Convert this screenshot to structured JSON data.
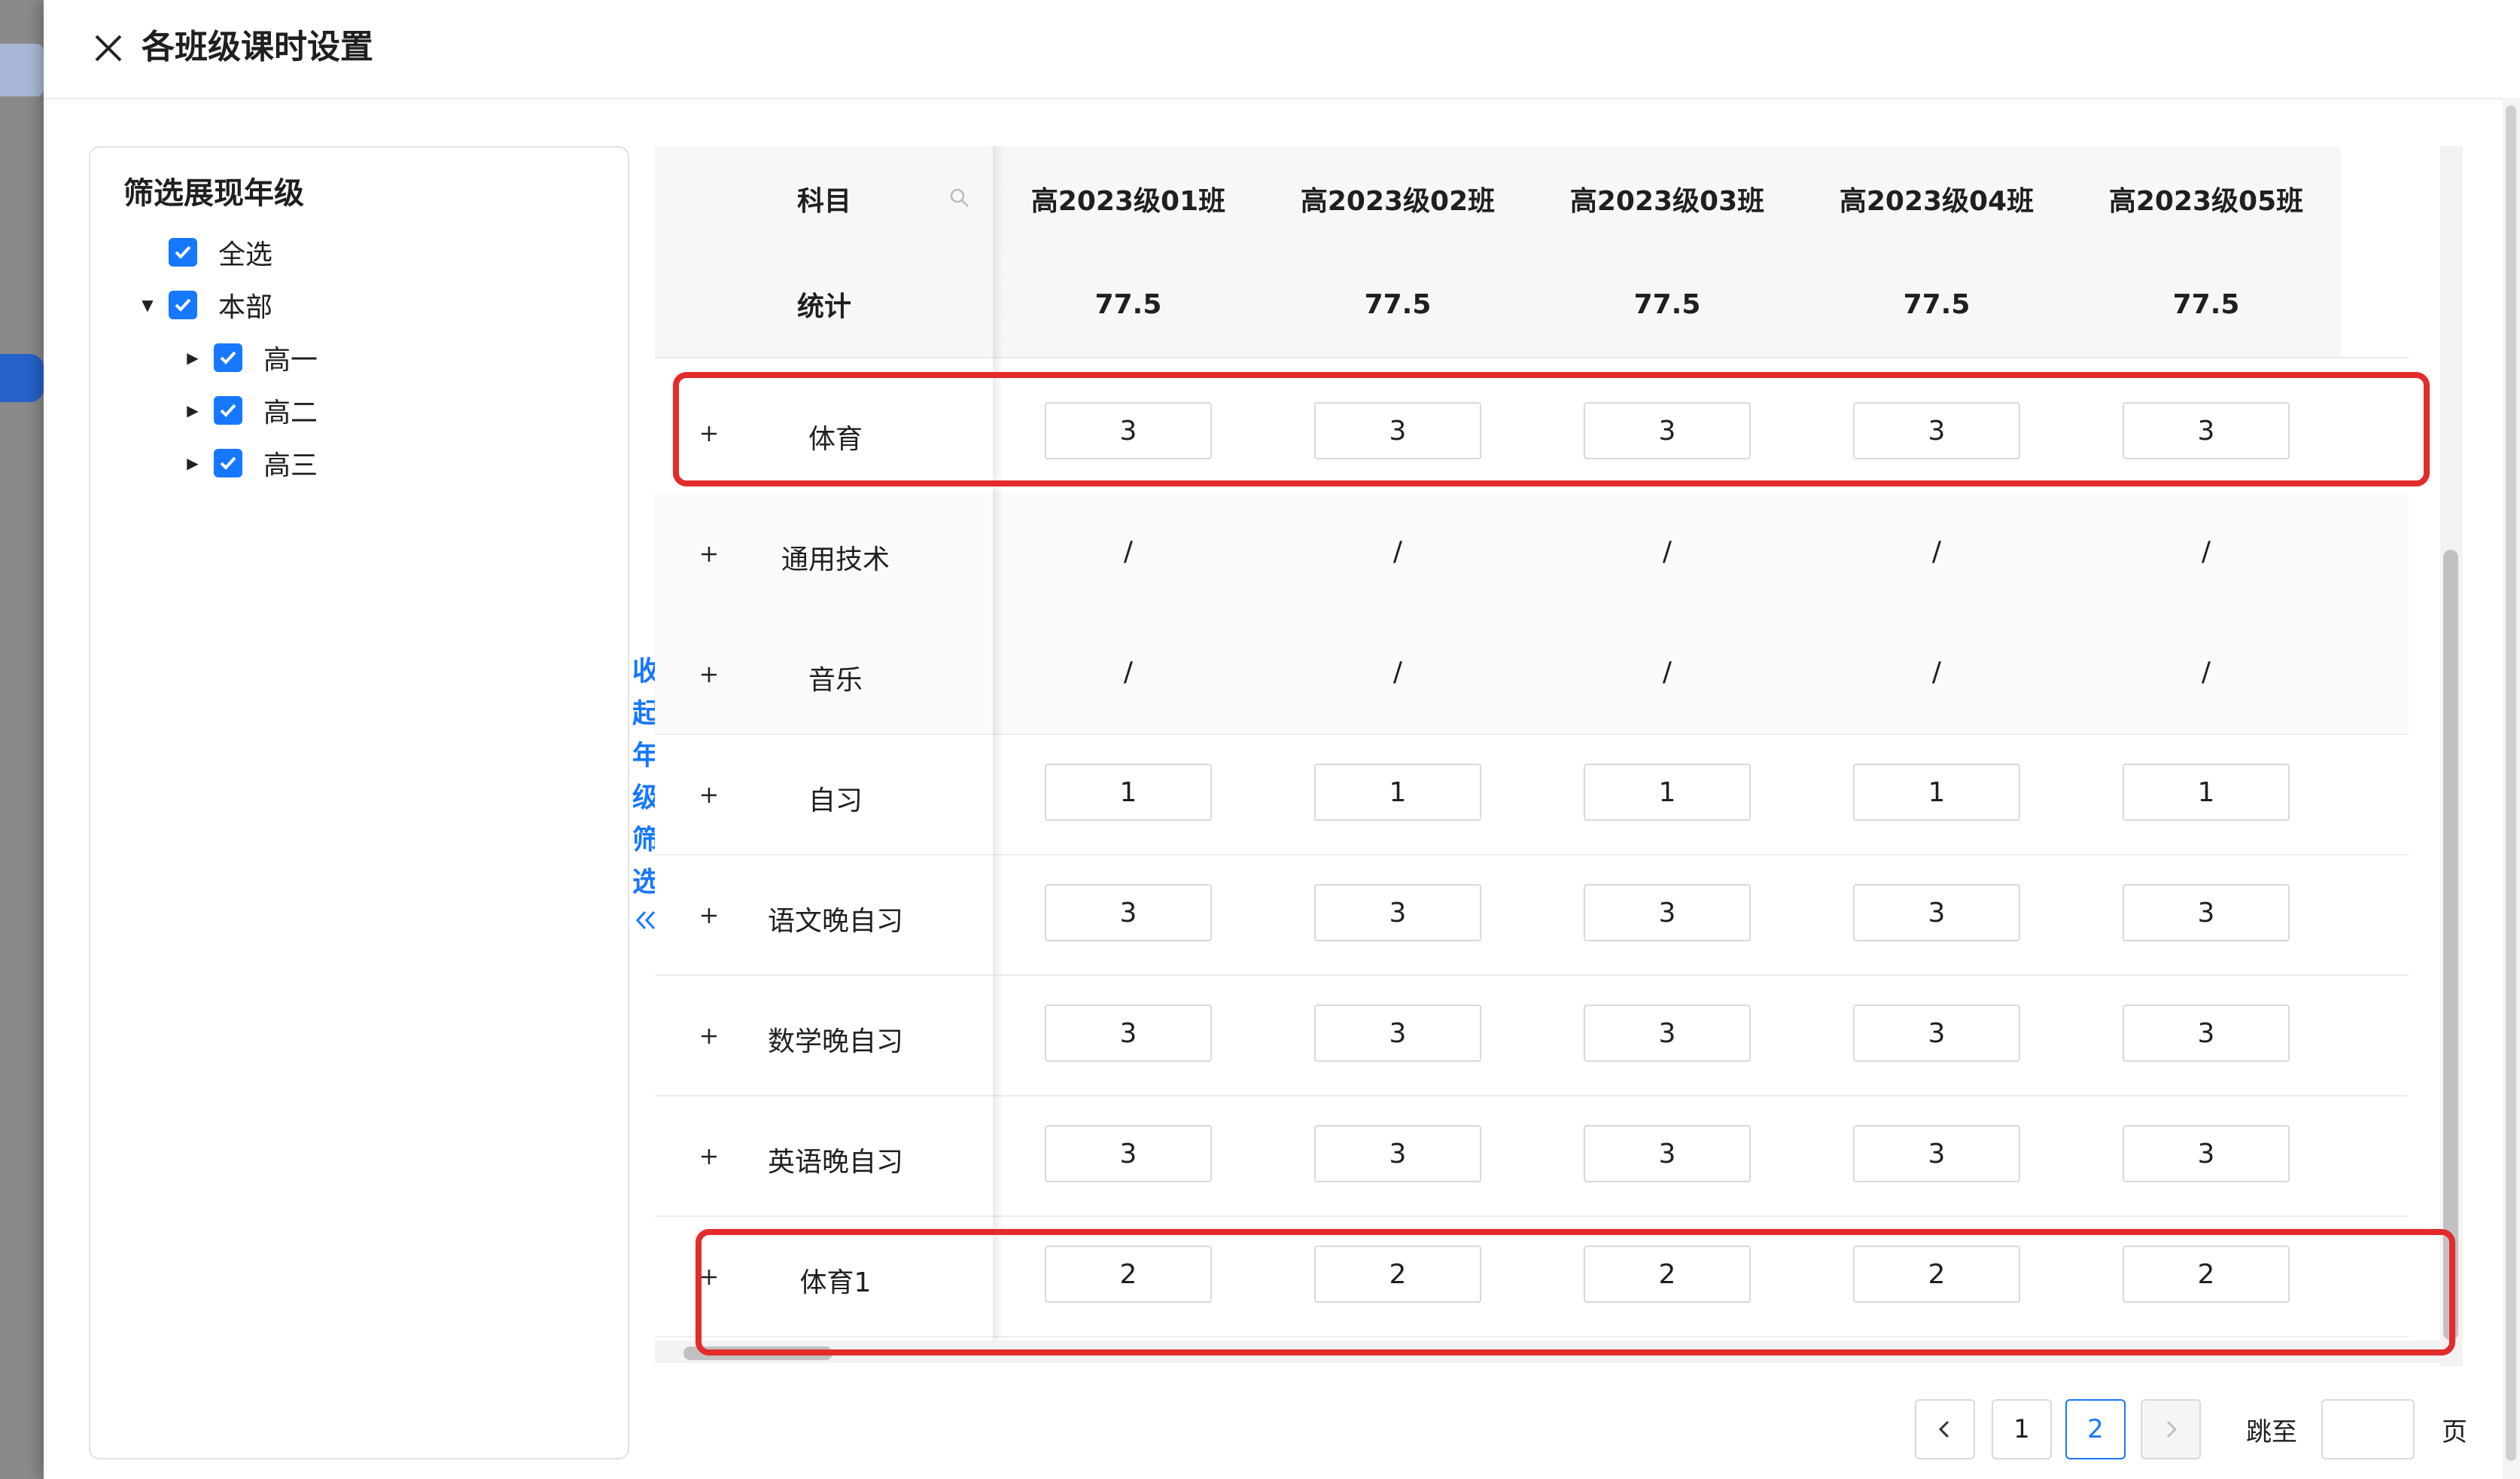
{
  "dialog": {
    "title": "各班级课时设置"
  },
  "filter": {
    "title": "筛选展现年级",
    "items": [
      {
        "label": "全选",
        "level": 0,
        "expandable": false
      },
      {
        "label": "本部",
        "level": 0,
        "expandable": true,
        "expanded": true
      },
      {
        "label": "高一",
        "level": 1,
        "expandable": true,
        "expanded": false
      },
      {
        "label": "高二",
        "level": 1,
        "expandable": true,
        "expanded": false
      },
      {
        "label": "高三",
        "level": 1,
        "expandable": true,
        "expanded": false
      }
    ],
    "collapse_chars": [
      "收",
      "起",
      "年",
      "级",
      "筛",
      "选"
    ]
  },
  "table": {
    "subject_header": "科目",
    "columns": [
      "高2023级01班",
      "高2023级02班",
      "高2023级03班",
      "高2023级04班",
      "高2023级05班"
    ],
    "stat_label": "统计",
    "stats": [
      "77.5",
      "77.5",
      "77.5",
      "77.5",
      "77.5"
    ],
    "rows": [
      {
        "subject": "体育",
        "editable": true,
        "values": [
          "3",
          "3",
          "3",
          "3",
          "3"
        ],
        "highlighted": true
      },
      {
        "subject": "通用技术",
        "editable": false,
        "values": [
          "/",
          "/",
          "/",
          "/",
          "/"
        ],
        "highlighted": false
      },
      {
        "subject": "音乐",
        "editable": false,
        "values": [
          "/",
          "/",
          "/",
          "/",
          "/"
        ],
        "highlighted": false
      },
      {
        "subject": "自习",
        "editable": true,
        "values": [
          "1",
          "1",
          "1",
          "1",
          "1"
        ],
        "highlighted": false
      },
      {
        "subject": "语文晚自习",
        "editable": true,
        "values": [
          "3",
          "3",
          "3",
          "3",
          "3"
        ],
        "highlighted": false
      },
      {
        "subject": "数学晚自习",
        "editable": true,
        "values": [
          "3",
          "3",
          "3",
          "3",
          "3"
        ],
        "highlighted": false
      },
      {
        "subject": "英语晚自习",
        "editable": true,
        "values": [
          "3",
          "3",
          "3",
          "3",
          "3"
        ],
        "highlighted": false
      },
      {
        "subject": "体育1",
        "editable": true,
        "values": [
          "2",
          "2",
          "2",
          "2",
          "2"
        ],
        "highlighted": true
      }
    ]
  },
  "pagination": {
    "pages": [
      "1",
      "2"
    ],
    "current": "2",
    "jump_label": "跳至",
    "page_suffix": "页"
  },
  "colors": {
    "accent": "#1677ff",
    "highlight": "#e32b2b"
  }
}
